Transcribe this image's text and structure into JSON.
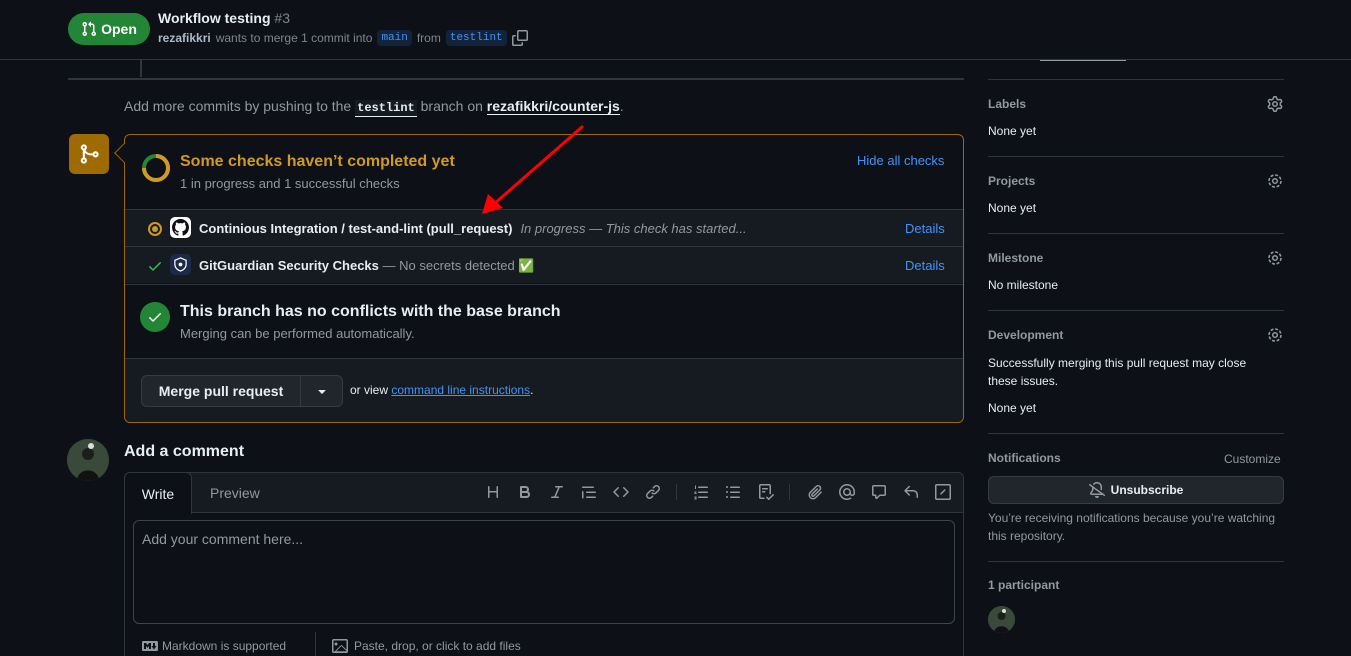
{
  "header": {
    "state": "Open",
    "title": "Workflow testing",
    "number": "#3",
    "author": "rezafikkri",
    "merge_text": "wants to merge 1 commit into",
    "base_branch": "main",
    "from_text": "from",
    "head_branch": "testlint"
  },
  "push_note": {
    "prefix": "Add more commits by pushing to the",
    "branch": "testlint",
    "middle": "branch on",
    "repo": "rezafikkri/counter-js",
    "suffix": "."
  },
  "checks": {
    "title": "Some checks haven’t completed yet",
    "subtitle": "1 in progress and 1 successful checks",
    "hide_label": "Hide all checks",
    "items": [
      {
        "name": "Continious Integration / test-and-lint (pull_request)",
        "description": "In progress — This check has started...",
        "details": "Details",
        "status": "in-progress"
      },
      {
        "name": "GitGuardian Security Checks",
        "description": "— No secrets detected ✅",
        "details": "Details",
        "status": "success"
      }
    ]
  },
  "conflicts": {
    "title": "This branch has no conflicts with the base branch",
    "subtitle": "Merging can be performed automatically."
  },
  "merge": {
    "button": "Merge pull request",
    "or_view": "or view",
    "cli_link": "command line instructions",
    "period": "."
  },
  "comment": {
    "heading": "Add a comment",
    "tab_write": "Write",
    "tab_preview": "Preview",
    "placeholder": "Add your comment here...",
    "markdown_note": "Markdown is supported",
    "paste_note": "Paste, drop, or click to add files"
  },
  "sidebar": {
    "labels": {
      "heading": "Labels",
      "value": "None yet"
    },
    "projects": {
      "heading": "Projects",
      "value": "None yet"
    },
    "milestone": {
      "heading": "Milestone",
      "value": "No milestone"
    },
    "development": {
      "heading": "Development",
      "description": "Successfully merging this pull request may close these issues.",
      "value": "None yet"
    },
    "notifications": {
      "heading": "Notifications",
      "customize": "Customize",
      "button": "Unsubscribe",
      "description": "You’re receiving notifications because you’re watching this repository."
    },
    "participants": {
      "heading": "1 participant"
    }
  },
  "colors": {
    "background": "#0d1117",
    "open_green": "#238636",
    "pending_yellow": "#d29922",
    "link_blue": "#4493f8",
    "annotation_red": "#ff0000"
  }
}
